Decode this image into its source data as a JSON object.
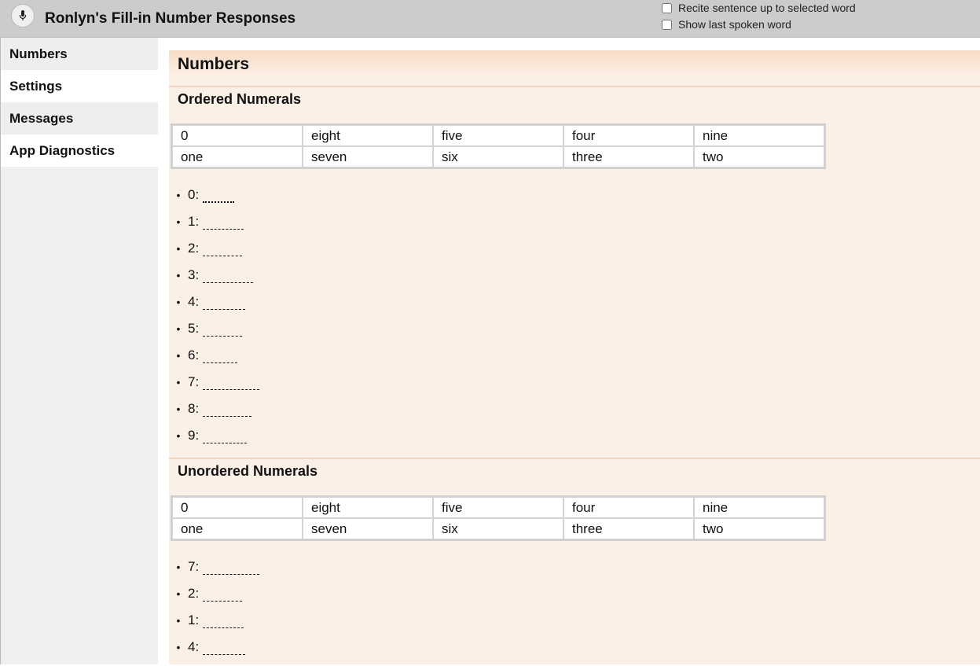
{
  "header": {
    "title": "Ronlyn's Fill-in Number Responses",
    "options": [
      {
        "label": "Recite sentence up to selected word",
        "checked": false
      },
      {
        "label": "Show last spoken word",
        "checked": false
      }
    ],
    "mic_icon": "microphone-icon"
  },
  "sidebar": {
    "items": [
      {
        "label": "Numbers",
        "active": false
      },
      {
        "label": "Settings",
        "active": true
      },
      {
        "label": "Messages",
        "active": false
      },
      {
        "label": "App Diagnostics",
        "active": false
      }
    ]
  },
  "main": {
    "title": "Numbers",
    "ordered": {
      "title": "Ordered Numerals",
      "table": [
        [
          "0",
          "eight",
          "five",
          "four",
          "nine"
        ],
        [
          "one",
          "seven",
          "six",
          "three",
          "two"
        ]
      ],
      "items": [
        "0:",
        "1:",
        "2:",
        "3:",
        "4:",
        "5:",
        "6:",
        "7:",
        "8:",
        "9:"
      ]
    },
    "unordered": {
      "title": "Unordered Numerals",
      "table": [
        [
          "0",
          "eight",
          "five",
          "four",
          "nine"
        ],
        [
          "one",
          "seven",
          "six",
          "three",
          "two"
        ]
      ],
      "items": [
        "7:",
        "2:",
        "1:",
        "4:"
      ]
    }
  },
  "colors": {
    "header_bg": "#cccccc",
    "sidebar_bg": "#eeeeee",
    "content_bg": "#fbf0e6",
    "accent_line": "#f3d6c0"
  }
}
